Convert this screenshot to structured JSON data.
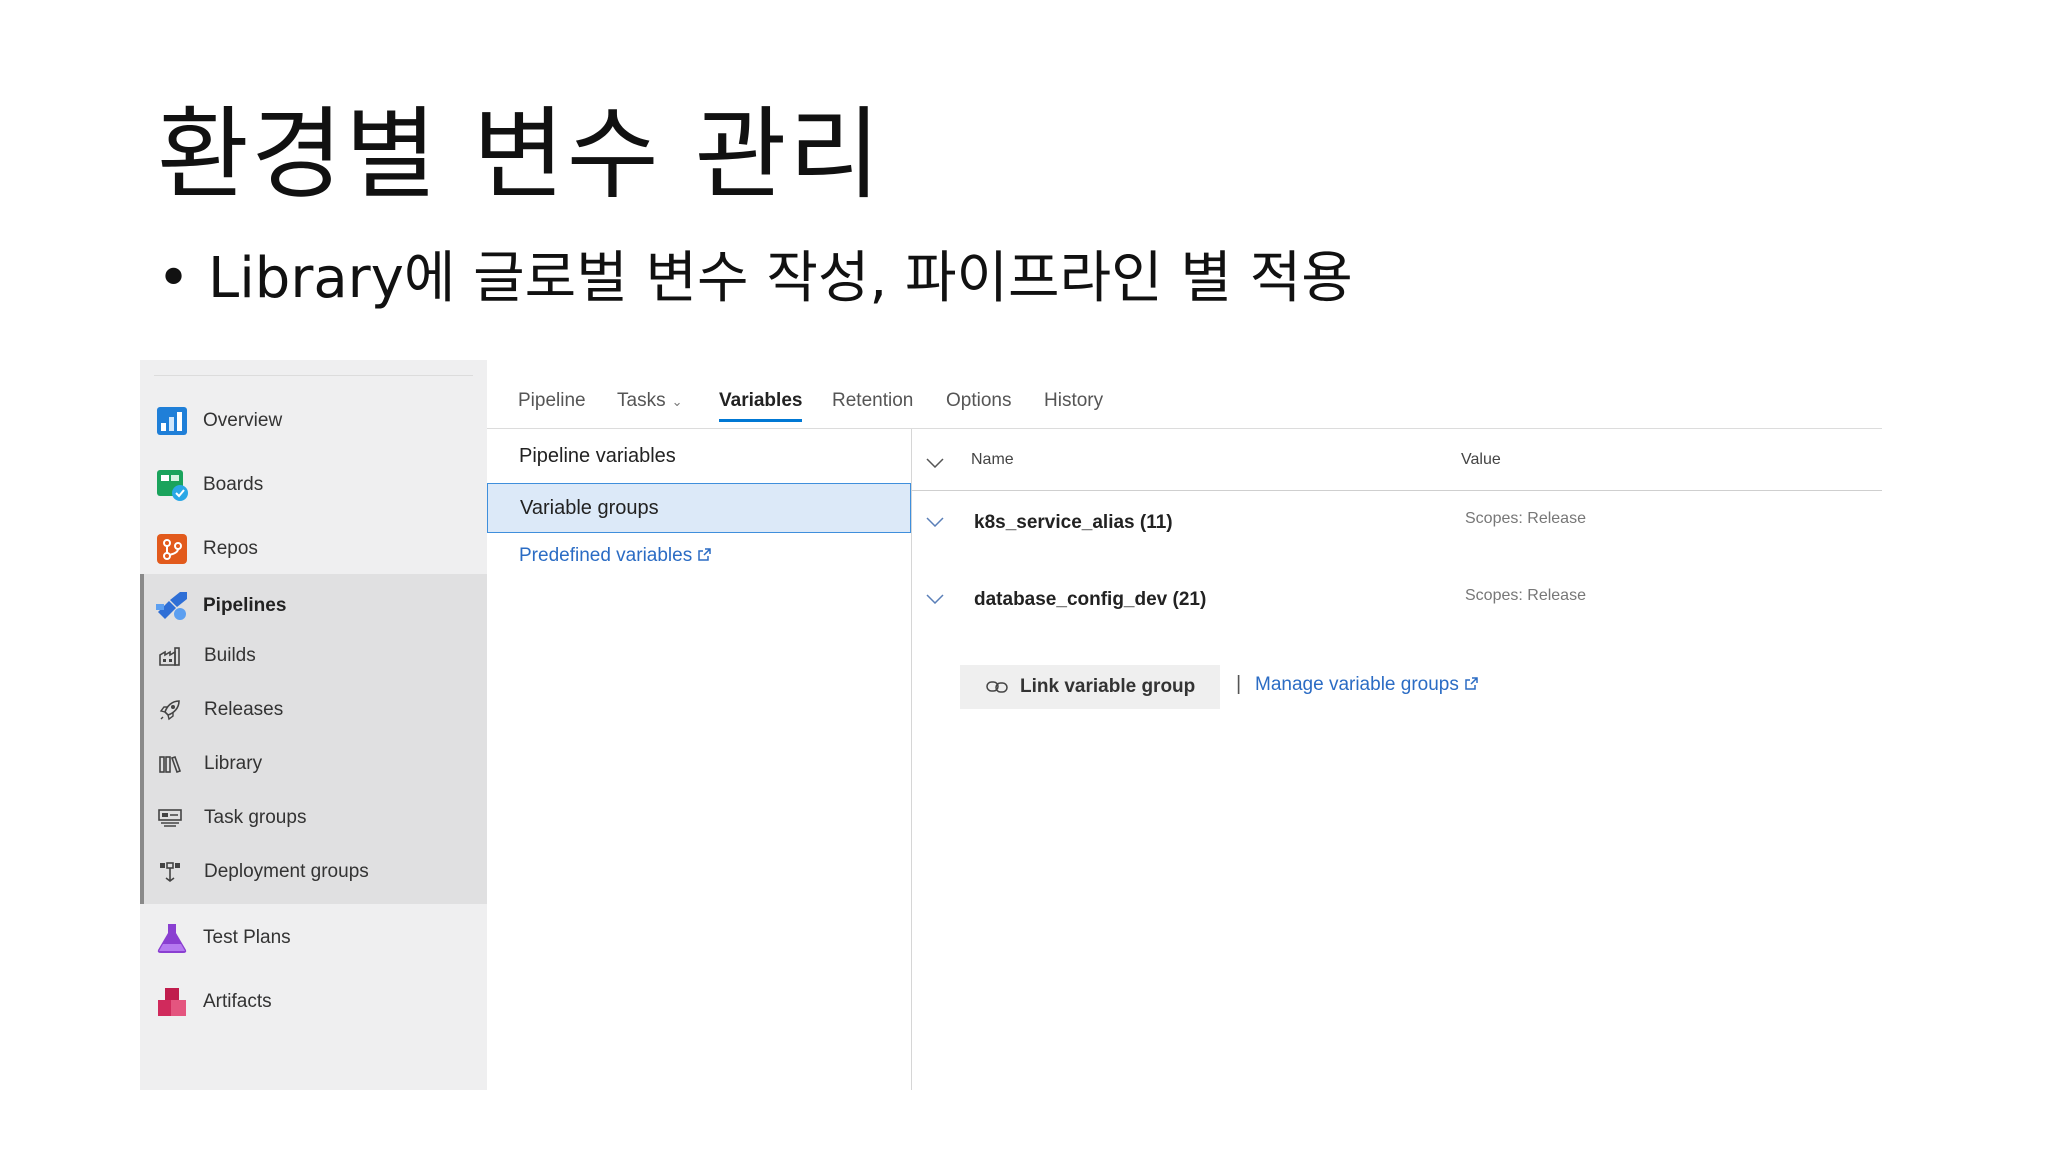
{
  "slide": {
    "title": "환경별 변수 관리",
    "bullet": "Library에 글로벌 변수 작성, 파이프라인 별 적용",
    "bullet_marker": "•"
  },
  "sidebar": {
    "items": [
      {
        "label": "Overview",
        "icon": "overview-icon"
      },
      {
        "label": "Boards",
        "icon": "boards-icon"
      },
      {
        "label": "Repos",
        "icon": "repos-icon"
      },
      {
        "label": "Pipelines",
        "icon": "pipelines-icon"
      },
      {
        "label": "Builds",
        "icon": "builds-icon"
      },
      {
        "label": "Releases",
        "icon": "releases-icon"
      },
      {
        "label": "Library",
        "icon": "library-icon"
      },
      {
        "label": "Task groups",
        "icon": "task-groups-icon"
      },
      {
        "label": "Deployment groups",
        "icon": "deployment-groups-icon"
      },
      {
        "label": "Test Plans",
        "icon": "test-plans-icon"
      },
      {
        "label": "Artifacts",
        "icon": "artifacts-icon"
      }
    ]
  },
  "tabs": [
    {
      "label": "Pipeline"
    },
    {
      "label": "Tasks"
    },
    {
      "label": "Variables",
      "active": true
    },
    {
      "label": "Retention"
    },
    {
      "label": "Options"
    },
    {
      "label": "History"
    }
  ],
  "left_panel": {
    "pipeline_variables": "Pipeline variables",
    "variable_groups": "Variable groups",
    "predefined_link": "Predefined variables"
  },
  "right_panel": {
    "col_name": "Name",
    "col_value": "Value",
    "groups": [
      {
        "name": "k8s_service_alias (11)",
        "scope": "Scopes: Release"
      },
      {
        "name": "database_config_dev (21)",
        "scope": "Scopes: Release"
      }
    ],
    "link_button": "Link variable group",
    "separator": "|",
    "manage_link": "Manage variable groups"
  },
  "colors": {
    "accent": "#0078d4",
    "link": "#2b6cc4",
    "selected_bg": "#dce9f8"
  }
}
